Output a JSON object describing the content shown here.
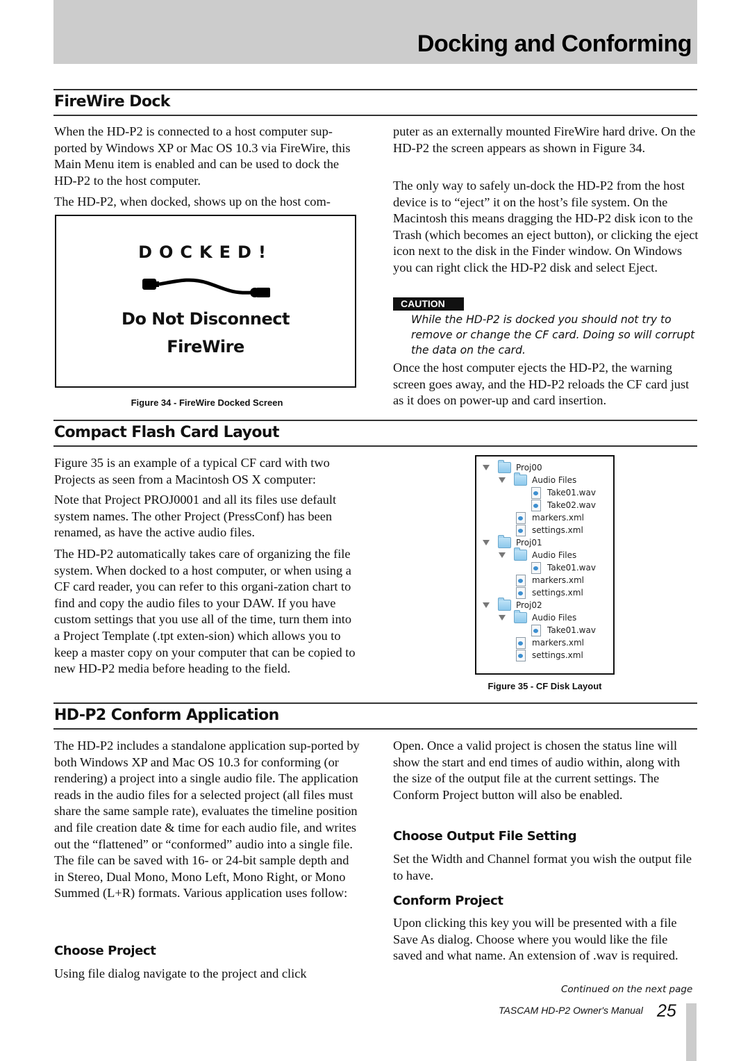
{
  "header": {
    "title": "Docking and Conforming"
  },
  "firewire": {
    "heading": "FireWire Dock",
    "left_p1": "When the HD-P2 is connected to a host computer sup-ported by Windows XP or Mac OS 10.3 via FireWire, this Main Menu item is enabled and can be used to dock the HD-P2 to the host computer.",
    "left_p2": "The HD-P2, when docked, shows up on the host com-",
    "right_p1": "puter as an externally mounted FireWire hard drive. On the HD-P2 the screen appears as shown in Figure 34.",
    "right_p2": "The only way to safely un-dock the HD-P2 from the host device is to “eject” it on the host’s file system. On the Macintosh this means dragging the HD-P2 disk icon to the Trash (which becomes an eject button), or clicking the eject icon next to the disk in the Finder window. On Windows you can right click the HD-P2 disk and select Eject.",
    "caution_label": "CAUTION",
    "caution_text": "While the HD-P2 is docked you should not try to remove or change the CF card. Doing so will corrupt the data on the card.",
    "right_p3": "Once the host computer ejects the HD-P2, the warning screen goes away, and the HD-P2 reloads the CF card just as it does on power-up and card insertion.",
    "figure": {
      "line1": "DOCKED!",
      "line2": "Do Not Disconnect",
      "line3": "FireWire",
      "icon": "firewire-cable-icon",
      "caption": "Figure 34 - FireWire Docked Screen"
    }
  },
  "cf_layout": {
    "heading": "Compact Flash Card Layout",
    "p1": "Figure 35 is an example of a typical CF card with two Projects as seen from a Macintosh OS X computer:",
    "p2": "Note that Project PROJ0001 and all its files use default system names. The other Project (PressConf) has been renamed, as have the active audio files.",
    "p3": "The HD-P2 automatically takes care of organizing the file system. When docked to a host computer, or when using a CF card reader, you can refer to this organi-zation chart to find and copy the audio files to your DAW. If you have custom settings that you use all of the time, turn them into a Project Template (.tpt exten-sion) which allows you to keep a master copy on your computer that can be copied to new HD-P2 media before heading to the field.",
    "figure": {
      "caption": "Figure 35 - CF Disk Layout",
      "tree": [
        {
          "name": "Proj00",
          "type": "folder",
          "level": 0,
          "expanded": true
        },
        {
          "name": "Audio Files",
          "type": "folder",
          "level": 1,
          "expanded": true
        },
        {
          "name": "Take01.wav",
          "type": "file",
          "level": 2
        },
        {
          "name": "Take02.wav",
          "type": "file",
          "level": 2
        },
        {
          "name": "markers.xml",
          "type": "file",
          "level": 1
        },
        {
          "name": "settings.xml",
          "type": "file",
          "level": 1
        },
        {
          "name": "Proj01",
          "type": "folder",
          "level": 0,
          "expanded": true
        },
        {
          "name": "Audio Files",
          "type": "folder",
          "level": 1,
          "expanded": true
        },
        {
          "name": "Take01.wav",
          "type": "file",
          "level": 2
        },
        {
          "name": "markers.xml",
          "type": "file",
          "level": 1
        },
        {
          "name": "settings.xml",
          "type": "file",
          "level": 1
        },
        {
          "name": "Proj02",
          "type": "folder",
          "level": 0,
          "expanded": true
        },
        {
          "name": "Audio Files",
          "type": "folder",
          "level": 1,
          "expanded": true
        },
        {
          "name": "Take01.wav",
          "type": "file",
          "level": 2
        },
        {
          "name": "markers.xml",
          "type": "file",
          "level": 1
        },
        {
          "name": "settings.xml",
          "type": "file",
          "level": 1
        }
      ]
    }
  },
  "conform": {
    "heading": "HD-P2 Conform Application",
    "p1": "The HD-P2 includes a standalone application sup-ported by both Windows XP and Mac OS 10.3 for conforming (or rendering) a project into a single audio file. The application reads in the audio files for a selected project (all files must share the same sample rate), evaluates the timeline position and file creation date & time for each audio file, and writes out the “flattened” or “conformed” audio into a single file. The file can be saved with 16- or 24-bit sample depth and in Stereo, Dual Mono, Mono Left, Mono Right, or Mono Summed (L+R) formats. Various application uses follow:",
    "choose_project_heading": "Choose Project",
    "choose_project_p": "Using file dialog navigate to the project and click",
    "right_p1": "Open. Once a valid project is chosen the status line will show the start and end times of audio within, along with the size of the output file at the current settings. The Conform Project button will also be enabled.",
    "output_heading": "Choose Output File Setting",
    "output_p": "Set the Width and Channel format you wish the output file to have.",
    "conform_heading": "Conform Project",
    "conform_p": "Upon clicking this key you will be presented with a file Save As dialog. Choose where you would like the file saved and what name. An extension of .wav is required."
  },
  "footer": {
    "continued": "Continued on the next page",
    "manual": "TASCAM  HD-P2 Owner's Manual",
    "page_number": "25"
  }
}
